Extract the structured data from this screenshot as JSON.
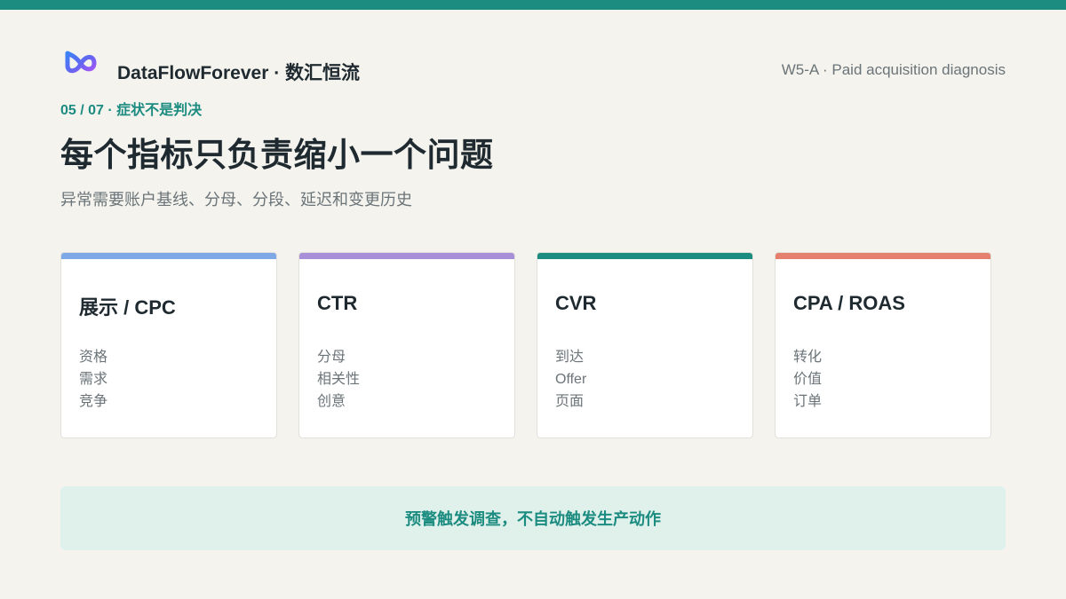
{
  "brand": {
    "name": "DataFlowForever · 数汇恒流"
  },
  "header": {
    "deck_label": "W5-A · Paid acquisition diagnosis"
  },
  "slide": {
    "eyebrow": "05 / 07 · 症状不是判决",
    "title": "每个指标只负责缩小一个问题",
    "subtitle": "异常需要账户基线、分母、分段、延迟和变更历史"
  },
  "cards": [
    {
      "title": "展示 / CPC",
      "accent": "#7fa8e6",
      "items": [
        "资格",
        "需求",
        "竞争"
      ]
    },
    {
      "title": "CTR",
      "accent": "#a890d8",
      "items": [
        "分母",
        "相关性",
        "创意"
      ]
    },
    {
      "title": "CVR",
      "accent": "#1c8c80",
      "items": [
        "到达",
        "Offer",
        "页面"
      ]
    },
    {
      "title": "CPA / ROAS",
      "accent": "#e57f6e",
      "items": [
        "转化",
        "价值",
        "订单"
      ]
    }
  ],
  "callout": {
    "text": "预警触发调查，不自动触发生产动作"
  },
  "colors": {
    "accent": "#1c8c80",
    "background": "#f4f3ee",
    "callout_bg": "#e0f1ec"
  },
  "icons": {
    "logo": "infinity-logo-icon"
  }
}
